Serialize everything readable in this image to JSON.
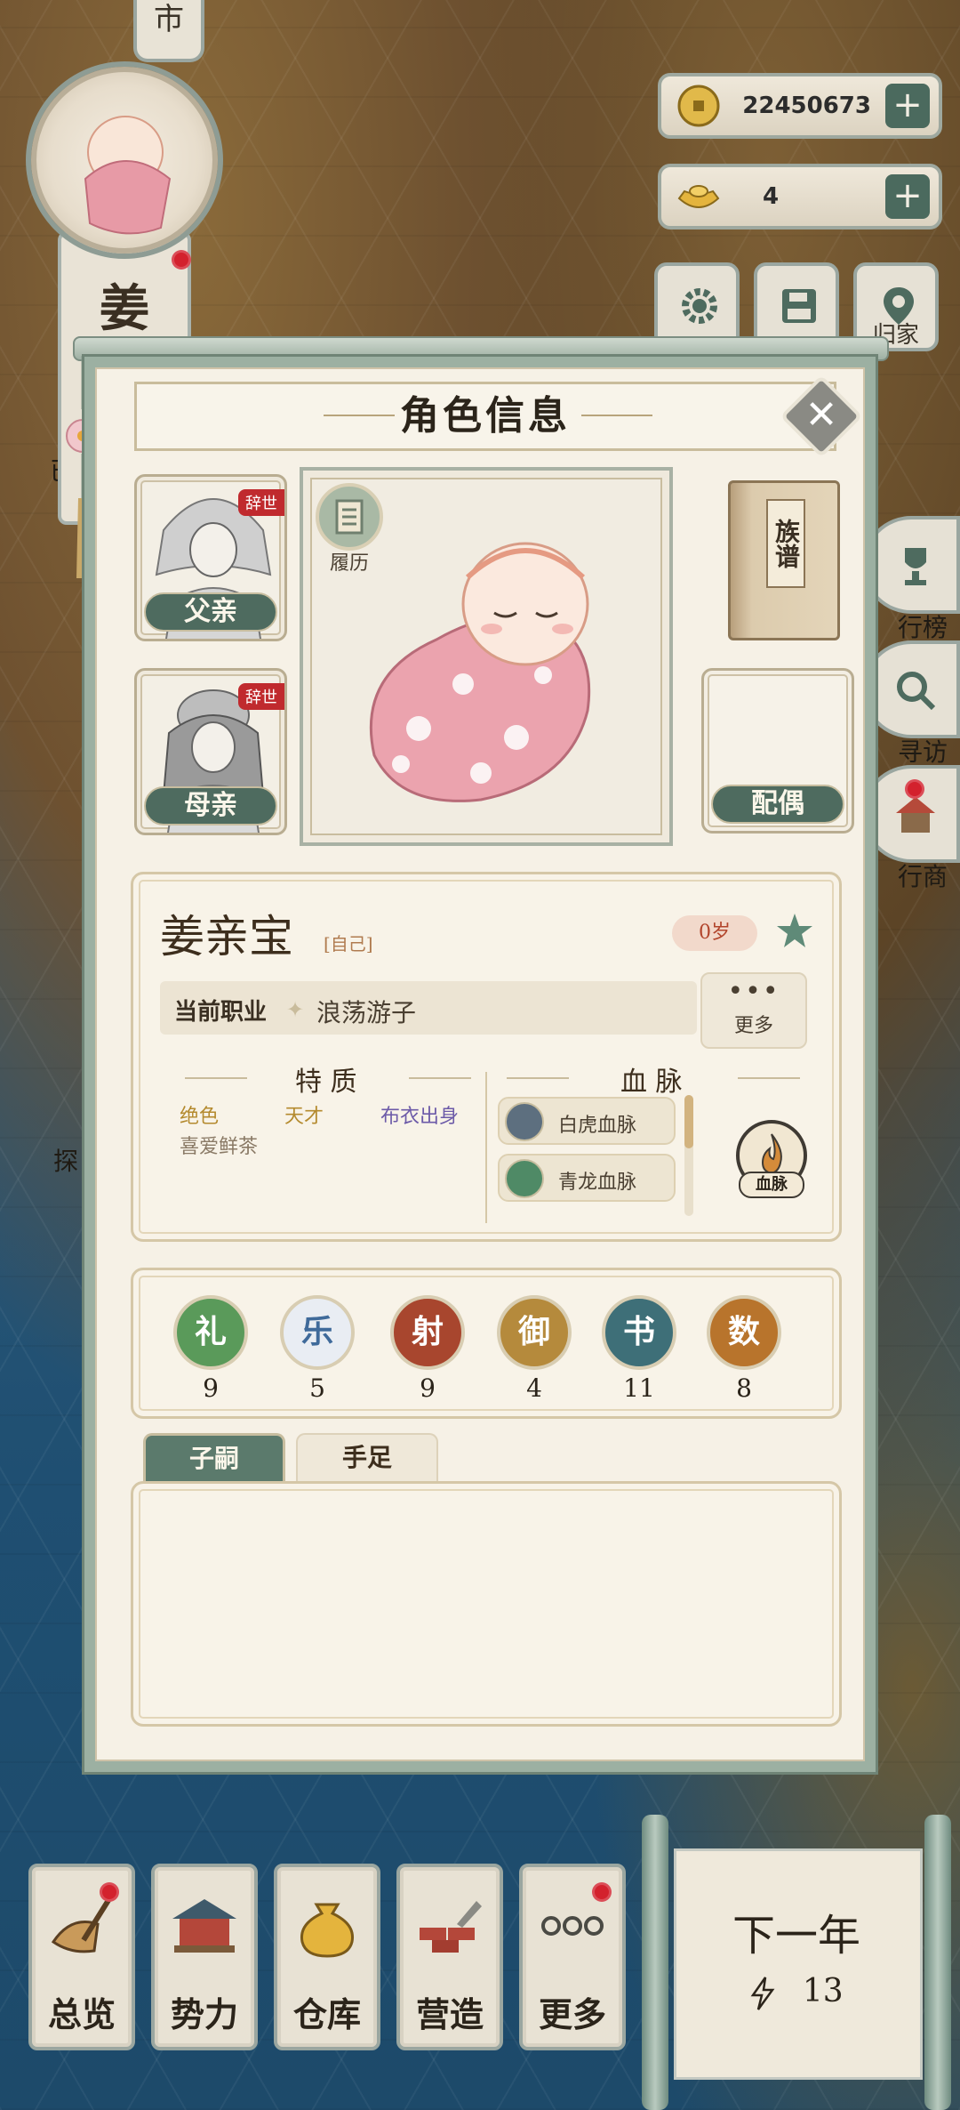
{
  "header": {
    "top_tab_char": "市",
    "banner_name": "姜",
    "map_label_left": "已",
    "map_label_explore": "探"
  },
  "currency": {
    "coins": "22450673",
    "ingots": "4"
  },
  "top_buttons": {
    "home_label": "归家"
  },
  "side_buttons": {
    "rank_label": "行榜",
    "visit_label": "寻访",
    "merchant_label": "行商"
  },
  "dialog": {
    "title": "角色信息",
    "father_label": "父亲",
    "mother_label": "母亲",
    "deceased_tag": "辞世",
    "resume_label": "履历",
    "genealogy_label": "族谱",
    "spouse_label": "配偶",
    "character": {
      "name": "姜亲宝",
      "self_tag": "[自己]",
      "age": "0岁",
      "job_key": "当前职业",
      "job_value": "浪荡游子",
      "more_label": "更多",
      "traits_title": "特 质",
      "traits": [
        "绝色",
        "天才",
        "布衣出身",
        "喜爱鲜茶"
      ],
      "bloodline_title": "血 脉",
      "bloodlines": [
        "白虎血脉",
        "青龙血脉"
      ],
      "bloodline_button": "血脉"
    },
    "skills": [
      {
        "char": "礼",
        "value": "9",
        "color": "#5a9a5a"
      },
      {
        "char": "乐",
        "value": "5",
        "color": "#7a9cc0"
      },
      {
        "char": "射",
        "value": "9",
        "color": "#a8462e"
      },
      {
        "char": "御",
        "value": "4",
        "color": "#b58a3c"
      },
      {
        "char": "书",
        "value": "11",
        "color": "#3e6f78"
      },
      {
        "char": "数",
        "value": "8",
        "color": "#b8742c"
      }
    ],
    "tabs": [
      "子嗣",
      "手足"
    ]
  },
  "bottom_nav": [
    {
      "label": "总览",
      "badge": true
    },
    {
      "label": "势力",
      "badge": false
    },
    {
      "label": "仓库",
      "badge": false
    },
    {
      "label": "营造",
      "badge": false
    },
    {
      "label": "更多",
      "badge": true
    }
  ],
  "next_year": {
    "label": "下一年",
    "energy": "13"
  },
  "colors": {
    "accent_green": "#4e6b5f",
    "badge_red": "#d3212d",
    "deceased_red": "#c02a2e"
  }
}
